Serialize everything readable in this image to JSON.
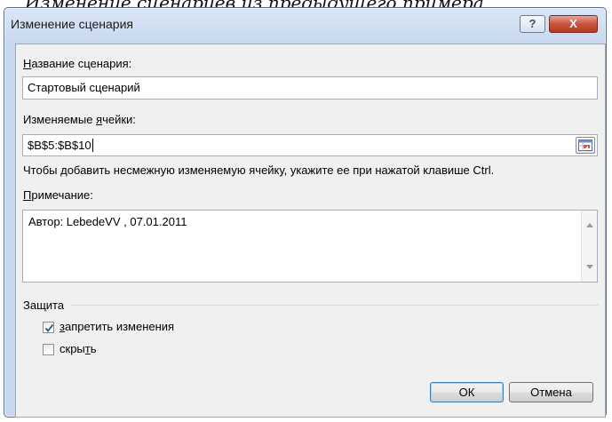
{
  "dialog": {
    "title": "Изменение сценария",
    "help_label": "?",
    "close_label": "X"
  },
  "scenario_name": {
    "label_accel": "Н",
    "label_rest": "азвание сценария:",
    "value": "Стартовый сценарий"
  },
  "changing_cells": {
    "label_pre": "Изменяемые ",
    "label_accel": "я",
    "label_post": "чейки:",
    "value": "$B$5:$B$10",
    "collapse_icon": "range-selector-icon"
  },
  "hint": "Чтобы добавить несмежную изменяемую ячейку, укажите ее при нажатой клавише Ctrl.",
  "comment": {
    "label_accel": "П",
    "label_rest": "римечание:",
    "value": "Автор: LebedeVV , 07.01.2011"
  },
  "protection": {
    "group_label": "Защита",
    "prevent_changes": {
      "accel": "з",
      "rest": "апретить изменения",
      "checked": true
    },
    "hide": {
      "pre": "скры",
      "accel": "т",
      "post": "ь",
      "checked": false
    }
  },
  "buttons": {
    "ok": "ОК",
    "cancel": "Отмена"
  },
  "caption_fragment": "Изменение  сценариев из предыдущего примера"
}
